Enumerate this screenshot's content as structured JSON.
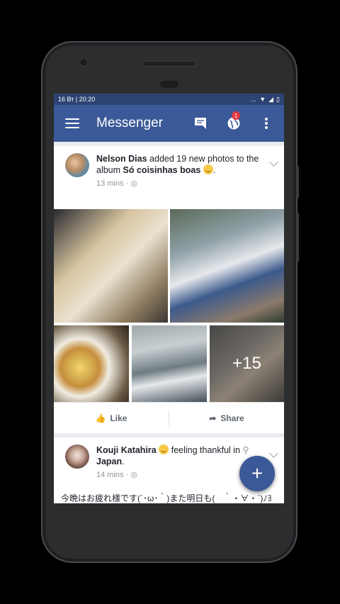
{
  "statusbar": {
    "left": "16 Вт  |  20:20",
    "right_icons": [
      "more-dots-icon",
      "wifi-icon",
      "signal-icon",
      "battery-icon"
    ]
  },
  "appbar": {
    "title": "Messenger",
    "notification_count": "1"
  },
  "posts": [
    {
      "author": "Nelson Dias",
      "text_before": "added 19 new photos to the album",
      "album": "Só coisinhas boas",
      "text_after": ".",
      "time": "13 mins ·",
      "more_photos": "+15",
      "actions": {
        "like": "Like",
        "share": "Share"
      }
    },
    {
      "author": "Kouji Katahira",
      "text_before": "feeling thankful in",
      "place": "Japan",
      "text_after": ".",
      "time": "14 mins ·",
      "body": "今晩はお疲れ様です(´･ω･｀)また明日も(　｀・∀・´)ﾉﾖ"
    }
  ],
  "fab": {
    "label": "+"
  },
  "colors": {
    "brand": "#3b5998",
    "statusbar": "#2d4373",
    "badge": "#e0393e"
  }
}
